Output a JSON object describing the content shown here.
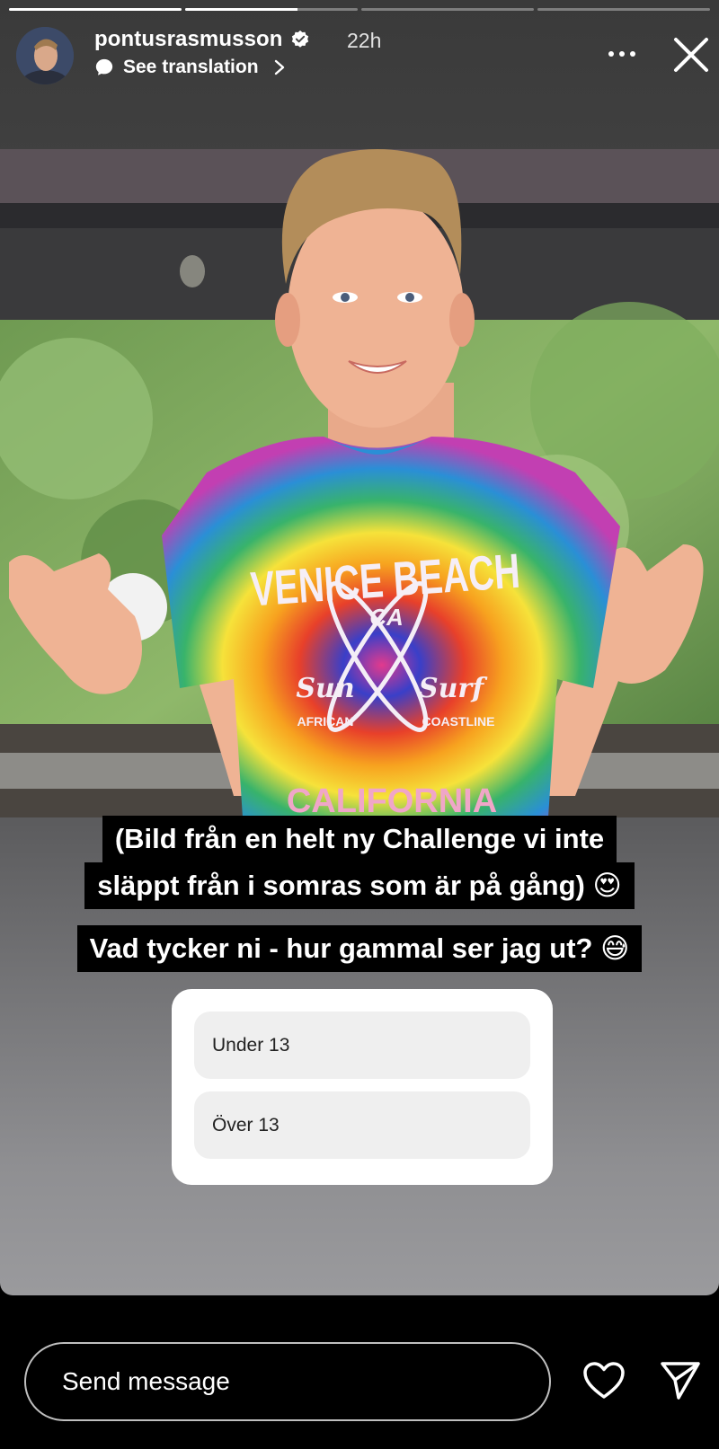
{
  "progress": [
    1,
    0.65,
    0,
    0
  ],
  "header": {
    "username": "pontusrasmusson",
    "time": "22h",
    "translate_label": "See translation",
    "avatar_icon": "avatar",
    "verified_icon": "verified-badge-icon",
    "more_icon": "more-icon",
    "close_icon": "close-icon"
  },
  "photo": {
    "shirt_line1": "VENICE BEACH",
    "shirt_ca": "CA",
    "shirt_sun": "Sun",
    "shirt_surf": "Surf",
    "shirt_left": "AFRICAN",
    "shirt_right": "COASTLINE",
    "shirt_bottom": "CALIFORNIA"
  },
  "captions": {
    "line1": "(Bild från en helt ny Challenge vi inte",
    "line2": "släppt från i somras som är på gång) 😍",
    "question": "Vad tycker ni - hur gammal ser jag ut? 😅"
  },
  "poll": {
    "options": [
      "Under 13",
      "Över 13"
    ]
  },
  "footer": {
    "message_placeholder": "Send message",
    "heart_icon": "heart-icon",
    "send_icon": "send-icon"
  }
}
